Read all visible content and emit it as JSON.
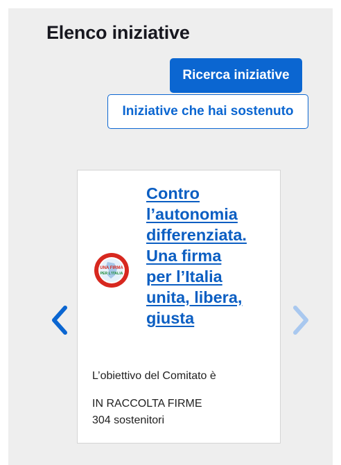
{
  "page": {
    "title": "Elenco iniziative"
  },
  "actions": {
    "search_label": "Ricerca iniziative",
    "supported_label": "Iniziative che hai sostenuto"
  },
  "carousel": {
    "prev_icon": "chevron-left-icon",
    "next_icon": "chevron-right-icon",
    "prev_color": "#0b66d1",
    "next_color": "#a9c8ef",
    "card": {
      "logo_icon": "una-firma-per-litalia-logo",
      "logo_text_line1": "UNA FIRMA",
      "logo_text_line2": "PER L'ITALIA",
      "title_lines": [
        "Contro",
        "l’autonomia",
        "differenziata.",
        "Una firma",
        "per l’Italia",
        "unita, libera,",
        "giusta"
      ],
      "description": "L’obiettivo del Comitato è",
      "status": "IN RACCOLTA FIRME",
      "supporters": "304 sostenitori"
    }
  },
  "colors": {
    "accent": "#0b66d1",
    "link": "#0b5ec2",
    "panel_bg": "#eeeeee"
  }
}
